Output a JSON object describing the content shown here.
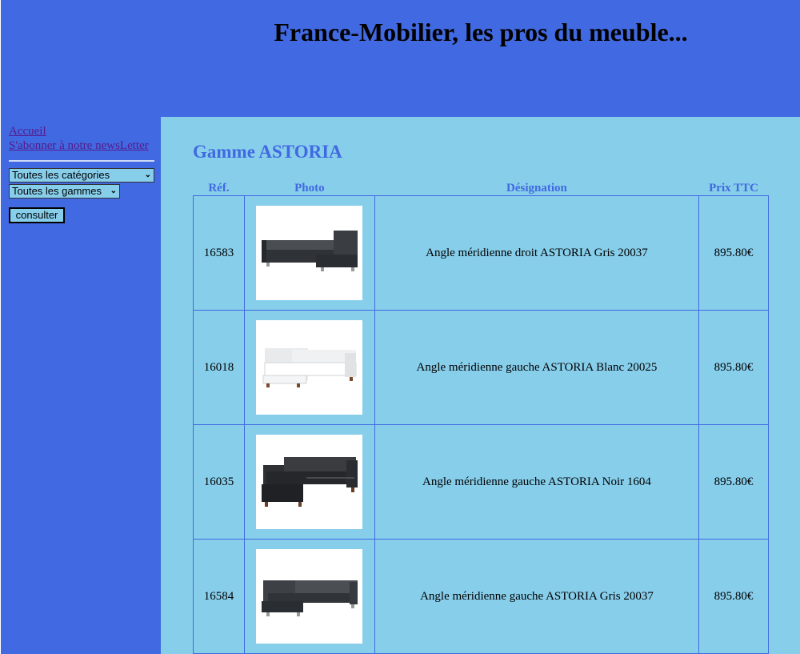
{
  "header": {
    "title": "France-Mobilier, les pros du meuble..."
  },
  "sidebar": {
    "links": {
      "home": "Accueil",
      "newsletter": "S'abonner à notre newsLetter"
    },
    "category_select": {
      "value": "Toutes les catégories"
    },
    "gamme_select": {
      "value": "Toutes les gammes"
    },
    "consult_button": "consulter"
  },
  "main": {
    "title": "Gamme ASTORIA",
    "columns": {
      "ref": "Réf.",
      "photo": "Photo",
      "designation": "Désignation",
      "price": "Prix TTC"
    },
    "rows": [
      {
        "ref": "16583",
        "designation": "Angle méridienne droit ASTORIA Gris 20037",
        "price": "895.80€",
        "photo": "sofa-dark-grey-right"
      },
      {
        "ref": "16018",
        "designation": "Angle méridienne gauche ASTORIA Blanc 20025",
        "price": "895.80€",
        "photo": "sofa-white-left"
      },
      {
        "ref": "16035",
        "designation": "Angle méridienne gauche ASTORIA Noir 1604",
        "price": "895.80€",
        "photo": "sofa-black-left"
      },
      {
        "ref": "16584",
        "designation": "Angle méridienne gauche ASTORIA Gris 20037",
        "price": "895.80€",
        "photo": "sofa-dark-grey-left"
      }
    ]
  },
  "colors": {
    "header_bg": "#4169e1",
    "content_bg": "#87ceeb",
    "accent": "#4169e1"
  }
}
